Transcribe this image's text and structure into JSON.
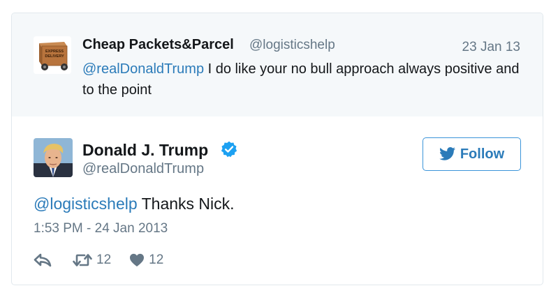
{
  "parent_tweet": {
    "author_name": "Cheap Packets&Parcel",
    "author_handle": "@logisticshelp",
    "date": "23 Jan 13",
    "mention": "@realDonaldTrump",
    "text": " I do like your no bull approach always positive and to the point",
    "avatar_icon": "express-delivery-box-icon",
    "avatar_text_line1": "EXPRESS",
    "avatar_text_line2": "DELIVERY"
  },
  "tweet": {
    "author_name": "Donald J. Trump",
    "author_handle": "@realDonaldTrump",
    "verified_icon": "verified-badge-icon",
    "follow_label": "Follow",
    "mention": "@logisticshelp",
    "text": " Thanks Nick.",
    "timestamp": "1:53 PM - 24 Jan 2013",
    "retweet_count": "12",
    "like_count": "12"
  },
  "colors": {
    "link": "#2b7bb9",
    "muted": "#657786",
    "verified": "#1da1f2",
    "parent_bg": "#f5f8fa",
    "border": "#e1e8ed"
  }
}
